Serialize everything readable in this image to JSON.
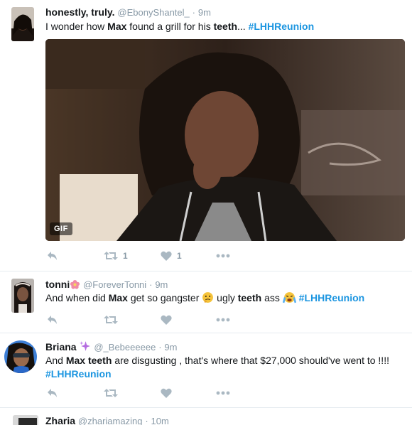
{
  "tweets": [
    {
      "display_name": "honestly, truly.",
      "handle": "@EbonyShantel_",
      "time": "9m",
      "text": [
        {
          "t": "I wonder how "
        },
        {
          "t": "Max",
          "b": true
        },
        {
          "t": " found a grill for his "
        },
        {
          "t": "teeth",
          "b": true
        },
        {
          "t": "... "
        },
        {
          "t": "#LHHReunion",
          "h": true
        }
      ],
      "media_badge": "GIF",
      "retweet_count": "1",
      "like_count": "1"
    },
    {
      "display_name": "tonni",
      "handle": "@ForeverTonni",
      "time": "9m",
      "text": [
        {
          "t": "And when did "
        },
        {
          "t": "Max",
          "b": true
        },
        {
          "t": " get so gangster "
        },
        {
          "emoji": "thinking"
        },
        {
          "t": " ugly "
        },
        {
          "t": "teeth",
          "b": true
        },
        {
          "t": " ass "
        },
        {
          "emoji": "crying"
        },
        {
          "t": " "
        },
        {
          "t": "#LHHReunion",
          "h": true
        }
      ],
      "retweet_count": "",
      "like_count": ""
    },
    {
      "display_name": "Briana",
      "handle": "@_Bebeeeeee",
      "time": "9m",
      "text": [
        {
          "t": "And "
        },
        {
          "t": "Max",
          "b": true
        },
        {
          "t": " "
        },
        {
          "t": "teeth",
          "b": true
        },
        {
          "t": " are disgusting , that's where that $27,000 should've went to !!!! "
        },
        {
          "t": "#LHHReunion",
          "h": true
        }
      ],
      "retweet_count": "",
      "like_count": ""
    },
    {
      "display_name": "Zharia",
      "handle": "@zhariamazing",
      "time": "10m"
    }
  ],
  "colors": {
    "link": "#1b95e0",
    "muted": "#8899a6",
    "icon": "#aab8c2",
    "separator": "#e6ecf0"
  },
  "icons": [
    "reply-icon",
    "retweet-icon",
    "like-icon",
    "more-icon",
    "sparkles-icon",
    "flower-icon",
    "thinking-emoji",
    "crying-emoji"
  ]
}
